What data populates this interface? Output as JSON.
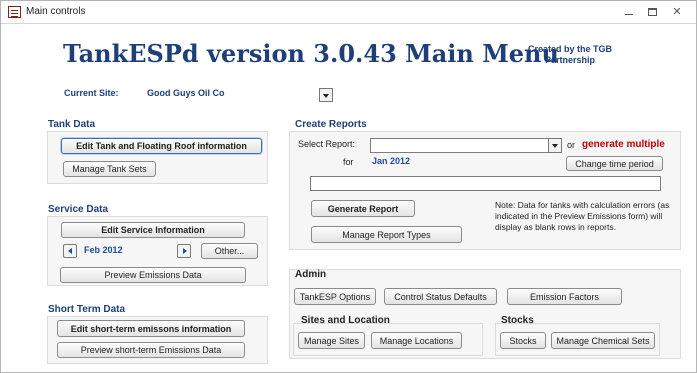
{
  "window": {
    "title": "Main controls",
    "controls": {
      "minimize": "minimize",
      "maximize": "maximize",
      "close": "✕"
    }
  },
  "header": {
    "title": "TankESPd version 3.0.43 Main Menu",
    "credit": "Created by the TGB Partnership"
  },
  "site": {
    "label": "Current Site:",
    "value": "Good Guys Oil Co"
  },
  "tank_data": {
    "title": "Tank Data",
    "edit_button": "Edit Tank and Floating Roof information",
    "sets_button": "Manage Tank Sets"
  },
  "service_data": {
    "title": "Service Data",
    "edit_button": "Edit Service Information",
    "month": "Feb 2012",
    "other_button": "Other...",
    "preview_button": "Preview Emissions Data"
  },
  "short_term": {
    "title": "Short Term Data",
    "edit_button": "Edit short-term emissons information",
    "preview_button": "Preview short-term Emissions Data"
  },
  "reports": {
    "title": "Create Reports",
    "select_label": "Select Report:",
    "select_value": "",
    "or_label": "or",
    "generate_multiple": "generate multiple",
    "for_label": "for",
    "period_value": "Jan 2012",
    "change_period_button": "Change time period",
    "generate_button": "Generate Report",
    "manage_types_button": "Manage Report Types",
    "note": "Note: Data for tanks with calculation errors (as indicated in the Preview Emissions form) will display as blank rows in reports."
  },
  "admin": {
    "title": "Admin",
    "options_button": "TankESP Options",
    "status_defaults_button": "Control Status Defaults",
    "emission_factors_button": "Emission Factors",
    "sites_title": "Sites and Location",
    "manage_sites_button": "Manage Sites",
    "manage_locations_button": "Manage Locations",
    "stocks_title": "Stocks",
    "stocks_button": "Stocks",
    "chemical_sets_button": "Manage Chemical Sets"
  },
  "colors": {
    "title_blue": "#1f3f7a",
    "accent_red": "#c00000",
    "panel_bg": "#f6f6f6"
  }
}
